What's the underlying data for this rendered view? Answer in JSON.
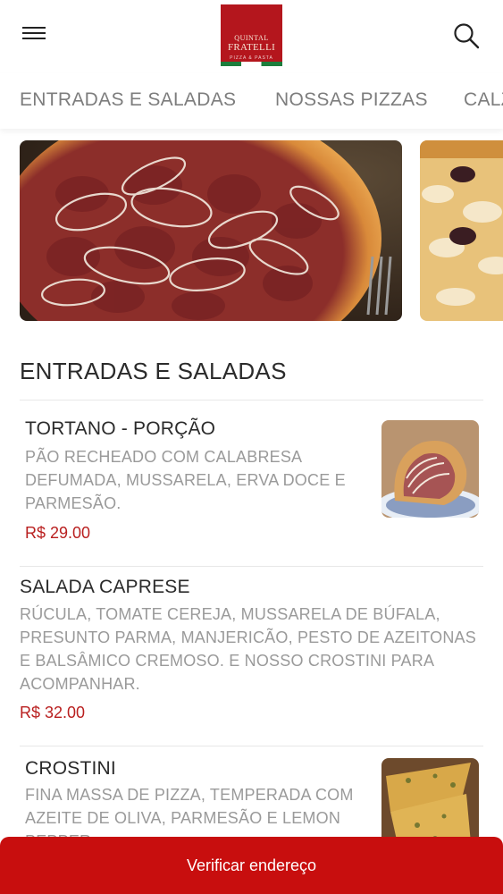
{
  "header": {
    "logo_line1": "QUINTAL",
    "logo_line2": "FRATELLI",
    "logo_tagline": "PIZZA & PASTA",
    "menu_icon": "hamburger-menu-icon",
    "search_icon": "search-icon"
  },
  "tabs": [
    {
      "label": "ENTRADAS E SALADAS"
    },
    {
      "label": "NOSSAS PIZZAS"
    },
    {
      "label": "CALZONES"
    }
  ],
  "section": {
    "title": "ENTRADAS E SALADAS"
  },
  "items": [
    {
      "name": "TORTANO - PORÇÃO",
      "desc_lines": [
        "PÃO RECHEADO COM CALABRESA",
        "DEFUMADA, MUSSARELA, ERVA DOCE E",
        "PARMESÃO."
      ],
      "price": "R$ 29.00"
    },
    {
      "name": "SALADA CAPRESE",
      "desc_lines": [
        "RÚCULA, TOMATE CEREJA, MUSSARELA DE BÚFALA,",
        "PRESUNTO PARMA, MANJERICÃO, PESTO DE AZEITONAS",
        "E BALSÂMICO CREMOSO. E NOSSO CROSTINI PARA",
        "ACOMPANHAR."
      ],
      "price": "R$ 32.00"
    },
    {
      "name": "CROSTINI",
      "desc_lines": [
        "FINA MASSA DE PIZZA, TEMPERADA COM",
        "AZEITE DE OLIVA, PARMESÃO E LEMON",
        "PEPPER"
      ],
      "price": ""
    }
  ],
  "cta": {
    "label": "Verificar endereço"
  },
  "colors": {
    "brand_red": "#c80e0e",
    "price_red": "#b91f1f",
    "logo_red": "#b4161d"
  }
}
